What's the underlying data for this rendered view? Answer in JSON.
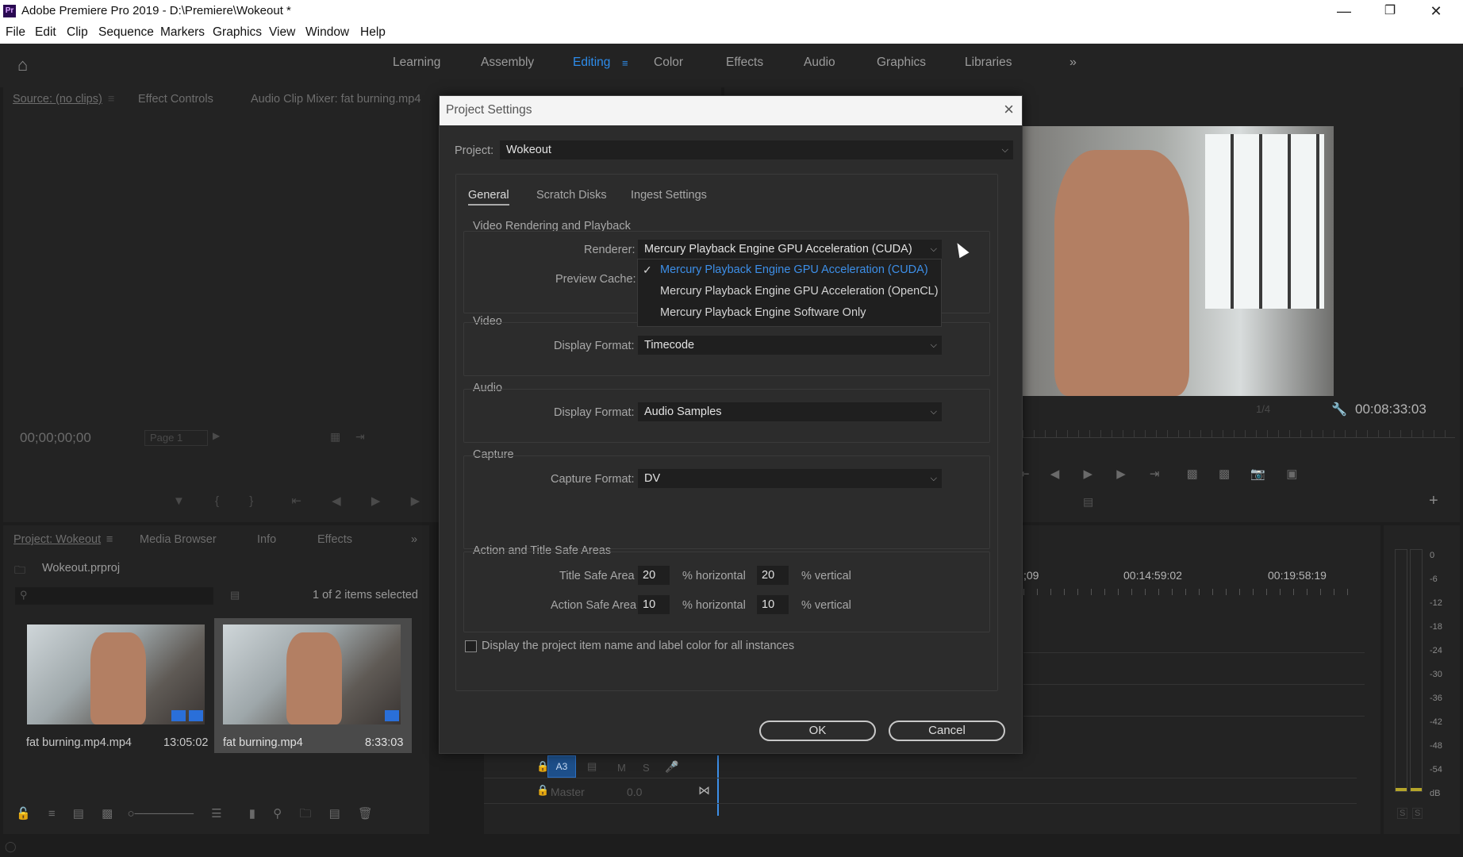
{
  "app": {
    "title": "Adobe Premiere Pro 2019 - D:\\Premiere\\Wokeout *",
    "logo_text": "Pr"
  },
  "menu": [
    "File",
    "Edit",
    "Clip",
    "Sequence",
    "Markers",
    "Graphics",
    "View",
    "Window",
    "Help"
  ],
  "workspaces": {
    "tabs": [
      "Learning",
      "Assembly",
      "Editing",
      "Color",
      "Effects",
      "Audio",
      "Graphics",
      "Libraries"
    ],
    "active": "Editing"
  },
  "source_panel": {
    "tabs": [
      "Source: (no clips)",
      "Effect Controls",
      "Audio Clip Mixer: fat burning.mp4"
    ],
    "timecode": "00;00;00;00",
    "page": "Page 1"
  },
  "program_panel": {
    "zoom": "1/4",
    "timecode": "00:08:33:03"
  },
  "timeline": {
    "ruler": [
      ";09",
      "00:14:59:02",
      "00:19:58:19"
    ],
    "track_a3": "A3",
    "track_labels": {
      "m": "M",
      "s": "S"
    },
    "master_label": "Master",
    "master_value": "0.0"
  },
  "meter": {
    "scale": [
      "0",
      "-6",
      "-12",
      "-18",
      "-24",
      "-30",
      "-36",
      "-42",
      "-48",
      "-54",
      "dB"
    ],
    "buttons": [
      "S",
      "S"
    ]
  },
  "project_panel": {
    "tabs": [
      "Project: Wokeout",
      "Media Browser",
      "Info",
      "Effects"
    ],
    "file": "Wokeout.prproj",
    "selection_status": "1 of 2 items selected",
    "items": [
      {
        "name": "fat burning.mp4.mp4",
        "duration": "13:05:02",
        "selected": false
      },
      {
        "name": "fat burning.mp4",
        "duration": "8:33:03",
        "selected": true
      }
    ]
  },
  "dialog": {
    "title": "Project Settings",
    "project_label": "Project:",
    "project_value": "Wokeout",
    "tabs": [
      "General",
      "Scratch Disks",
      "Ingest Settings"
    ],
    "active_tab": "General",
    "video_rendering": {
      "title": "Video Rendering and Playback",
      "renderer_label": "Renderer:",
      "renderer_value": "Mercury Playback Engine GPU Acceleration (CUDA)",
      "preview_cache_label": "Preview Cache:",
      "renderer_options": [
        {
          "label": "Mercury Playback Engine GPU Acceleration (CUDA)",
          "selected": true
        },
        {
          "label": "Mercury Playback Engine GPU Acceleration (OpenCL)",
          "selected": false
        },
        {
          "label": "Mercury Playback Engine Software Only",
          "selected": false
        }
      ]
    },
    "video": {
      "title": "Video",
      "display_format_label": "Display Format:",
      "display_format_value": "Timecode"
    },
    "audio": {
      "title": "Audio",
      "display_format_label": "Display Format:",
      "display_format_value": "Audio Samples"
    },
    "capture": {
      "title": "Capture",
      "capture_format_label": "Capture Format:",
      "capture_format_value": "DV"
    },
    "safe_areas": {
      "title": "Action and Title Safe Areas",
      "title_safe_label": "Title Safe Area",
      "title_h": "20",
      "title_v": "20",
      "action_safe_label": "Action Safe Area",
      "action_h": "10",
      "action_v": "10",
      "horizontal_unit": "% horizontal",
      "vertical_unit": "% vertical"
    },
    "display_name_checkbox": {
      "label": "Display the project item name and label color for all instances",
      "checked": false
    },
    "ok_label": "OK",
    "cancel_label": "Cancel"
  }
}
